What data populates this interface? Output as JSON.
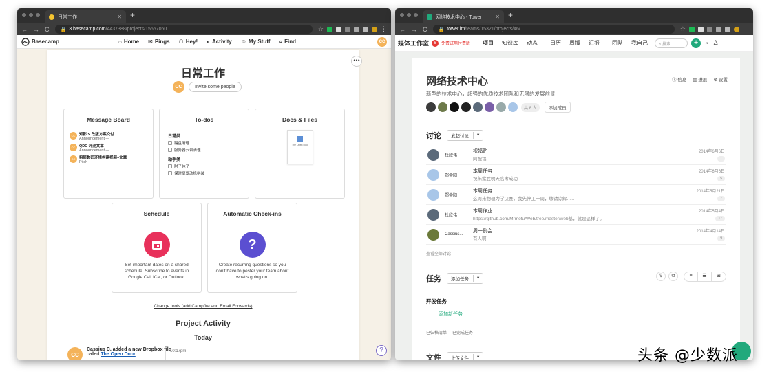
{
  "left": {
    "tab_title": "日常工作",
    "url_host": "3.basecamp.com",
    "url_path": "/4437388/projects/15657060",
    "brand": "Basecamp",
    "nav": [
      "Home",
      "Pings",
      "Hey!",
      "Activity",
      "My Stuff",
      "Find"
    ],
    "user_initials": "CC",
    "project_title": "日常工作",
    "invite_label": "Invite some people",
    "message_board": {
      "title": "Message Board",
      "items": [
        {
          "title": "知影 S 改版方案交付",
          "meta": "Announcement —"
        },
        {
          "title": "QDC 评测文章",
          "meta": "Announcement —"
        },
        {
          "title": "租屋数码环境构建视频+文章",
          "meta": "Pitch —"
        }
      ]
    },
    "todos": {
      "title": "To-dos",
      "groups": [
        {
          "name": "日常类",
          "items": [
            "键盘清理",
            "服务器云台清理"
          ]
        },
        {
          "name": "动手类",
          "items": [
            "肘子炖了",
            "保时捷发动机拼装"
          ]
        }
      ]
    },
    "docs": {
      "title": "Docs & Files",
      "doc_label": "The Open Door"
    },
    "schedule": {
      "title": "Schedule",
      "desc": "Set important dates on a shared schedule. Subscribe to events in Google Cal, iCal, or Outlook."
    },
    "checkins": {
      "title": "Automatic Check-ins",
      "desc": "Create recurring questions so you don't have to pester your team about what's going on."
    },
    "change_tools": "Change tools (add Campfire and Email Forwards)",
    "activity_title": "Project Activity",
    "today": "Today",
    "activity": {
      "line1": "Cassius C. added a new Dropbox file",
      "called": "called",
      "file": "The Open Door",
      "time": "10:17pm"
    }
  },
  "right": {
    "tab_title": "网络技术中心 - Tower",
    "url_host": "tower.im",
    "url_path": "/teams/15321/projects/46/",
    "team": "媒体工作室",
    "badge": "6",
    "trial": "免费试用付费版",
    "nav": [
      "项目",
      "知识库",
      "动态",
      "日历",
      "周报",
      "汇报",
      "团队",
      "我自己"
    ],
    "search_placeholder": "搜索",
    "project_title": "网络技术中心",
    "project_desc": "新型的技术中心，超强的优质技术团队和无限的发展前景",
    "right_links": [
      "信息",
      "进展",
      "设置"
    ],
    "member_count": "共 8 人",
    "add_member": "添加成员",
    "discussion": {
      "title": "讨论",
      "button": "发起讨论",
      "rows": [
        {
          "user": "杜欣伟",
          "title": "祝福贴",
          "body": "同祝福",
          "date": "2014年6月6日",
          "count": "1",
          "color": "#5b6a7a"
        },
        {
          "user": "郑金阳",
          "title": "本周任务",
          "body": "祝陈紫胜明天高考成功",
          "date": "2014年6月6日",
          "count": "5",
          "color": "#a8c6e8"
        },
        {
          "user": "郑金阳",
          "title": "本周任务",
          "body": "这周末物理力学决赛，我先停工一周，敬请谅解……",
          "date": "2014年5月21日",
          "count": "7",
          "color": "#a8c6e8"
        },
        {
          "user": "杜欣伟",
          "title": "本周作业",
          "body": "https://github.com/Mrmofu/Web/tree/master/web基，就是这样了。",
          "date": "2014年5月4日",
          "count": "17",
          "color": "#5b6a7a"
        },
        {
          "user": "Cassius...",
          "title": "周一例会",
          "body": "有人啊",
          "date": "2014年4月14日",
          "count": "9",
          "color": "#6b7a3a"
        }
      ],
      "see_all": "查看全部讨论"
    },
    "tasks": {
      "title": "任务",
      "button": "添加任务",
      "group": "开发任务",
      "add": "添加新任务",
      "links": [
        "已归档清单",
        "已完成任务"
      ]
    },
    "files": {
      "title": "文件",
      "button": "上传文件"
    }
  },
  "watermark": "头条 @少数派"
}
